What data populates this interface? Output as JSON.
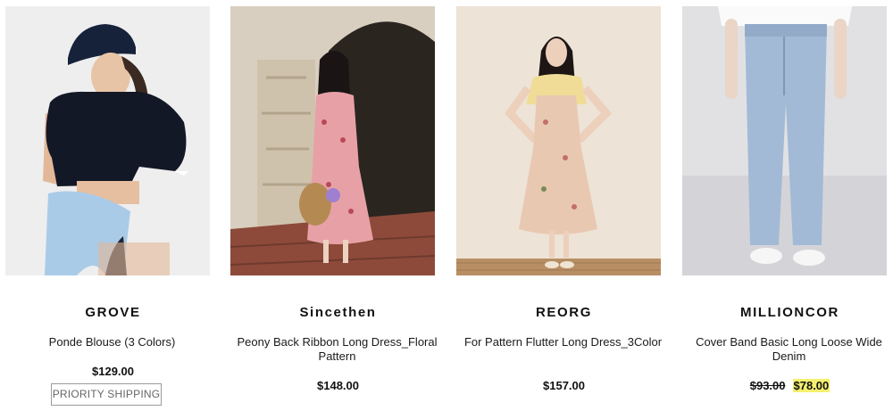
{
  "products": [
    {
      "brand": "GROVE",
      "name": "Ponde Blouse (3 Colors)",
      "price": "$129.00",
      "badge": "PRIORITY SHIPPING"
    },
    {
      "brand": "Sincethen",
      "name": "Peony Back Ribbon Long Dress_Floral Pattern",
      "price": "$148.00"
    },
    {
      "brand": "REORG",
      "name": "For Pattern Flutter Long Dress_3Color",
      "price": "$157.00"
    },
    {
      "brand": "MILLIONCOR",
      "name": "Cover Band Basic Long Loose Wide Denim",
      "original_price": "$93.00",
      "sale_price": "$78.00"
    }
  ],
  "colors": {
    "sale_highlight": "#f5f06e",
    "badge_border": "#9a9a9a"
  }
}
